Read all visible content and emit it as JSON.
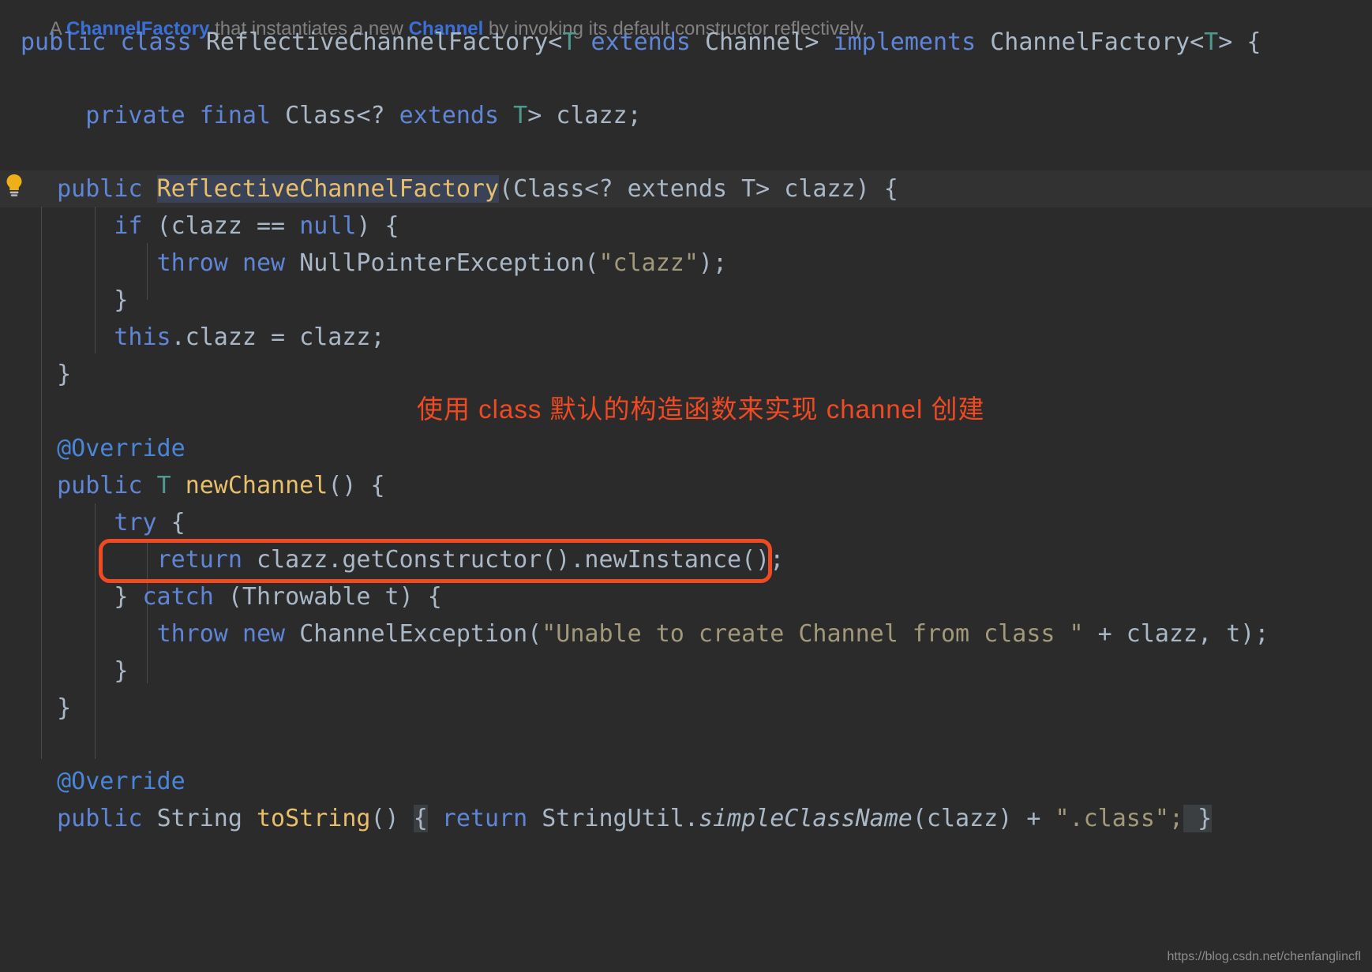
{
  "editor": {
    "theme_background": "#2b2b2b",
    "foreground": "#a9b7c6",
    "current_row_background": "#323232",
    "selection_background": "#3a4257",
    "accent_red": "#f04a23",
    "font_size_px": 30
  },
  "javadoc": {
    "prefix": "A ",
    "link1": "ChannelFactory",
    "middle": " that instantiates a new ",
    "link2": "Channel",
    "suffix": " by invoking its default constructor reflectively."
  },
  "code": {
    "class_decl": {
      "modifier": "public",
      "keyword": "class",
      "name": "ReflectiveChannelFactory",
      "generic_open": "<",
      "type_param": "T",
      "extends": "extends",
      "bound": "Channel",
      "generic_close": ">",
      "implements": "implements",
      "interface": "ChannelFactory",
      "iface_generic": "<T>",
      "open_brace": "{"
    },
    "field": {
      "modifier": "private",
      "final": "final",
      "type": "Class<?",
      "extends": "extends",
      "type_param": "T",
      "close": ">",
      "name": "clazz;"
    },
    "constructor": {
      "modifier": "public",
      "name": "ReflectiveChannelFactory",
      "params": "(Class<? extends T> clazz) {",
      "selected": true
    },
    "null_check": {
      "if_kw": "if",
      "cond_open": " (clazz == ",
      "null_kw": "null",
      "cond_close": ") {"
    },
    "throw_npe": {
      "throw_kw": "throw",
      "new_kw": "new",
      "exception": "NullPointerException(",
      "arg": "\"clazz\"",
      "tail": ");"
    },
    "close_if": "}",
    "assign": "this.clazz = clazz;",
    "close_ctor": "}",
    "override_1": "@Override",
    "new_channel_sig": {
      "modifier": "public",
      "return_type": "T",
      "name": "newChannel",
      "tail": "() {"
    },
    "try_kw": "try",
    "try_open": " {",
    "return_line": {
      "return_kw": "return",
      "expr": " clazz.getConstructor().newInstance();"
    },
    "catch_line": {
      "close_brace": "} ",
      "catch_kw": "catch",
      "params": " (Throwable t) {"
    },
    "throw_channel_exception": {
      "throw_kw": "throw",
      "new_kw": "new",
      "exception": "ChannelException(",
      "message": "\"Unable to create Channel from class \"",
      "tail": " + clazz, t);"
    },
    "close_catch": "}",
    "close_method": "}",
    "override_2": "@Override",
    "to_string": {
      "modifier": "public",
      "return_type": "String",
      "name": "toString",
      "sig_tail": "() ",
      "open_brace": "{",
      "return_kw": " return ",
      "util": "StringUtil.",
      "method": "simpleClassName",
      "arg": "(clazz)",
      "plus": " + ",
      "suffix_str": "\".class\";",
      "close_brace": " }"
    }
  },
  "annotation": {
    "chinese_note": "使用 class 默认的构造函数来实现 channel 创建",
    "color": "#f04a23"
  },
  "watermark": {
    "text": "https://blog.csdn.net/chenfanglincfl"
  },
  "icons": {
    "lightbulb": "intention-bulb"
  }
}
